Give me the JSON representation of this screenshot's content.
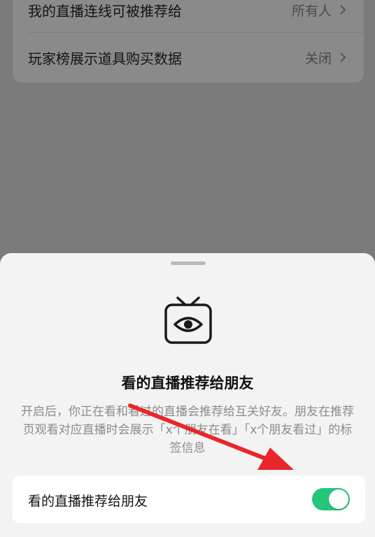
{
  "settings": {
    "rows": [
      {
        "label": "我的直播连线可被推荐给",
        "value": "所有人"
      },
      {
        "label": "玩家榜展示道具购买数据",
        "value": "关闭"
      }
    ]
  },
  "sheet": {
    "icon": "tv-eye-icon",
    "title": "看的直播推荐给朋友",
    "description": "开启后，你正在看和看过的直播会推荐给互关好友。朋友在推荐页观看对应直播时会展示「x个朋友在看」「x个朋友看过」的标签信息",
    "toggle": {
      "label": "看的直播推荐给朋友",
      "enabled": true
    }
  },
  "colors": {
    "switch_on": "#25c67b",
    "arrow": "#e8262b"
  }
}
